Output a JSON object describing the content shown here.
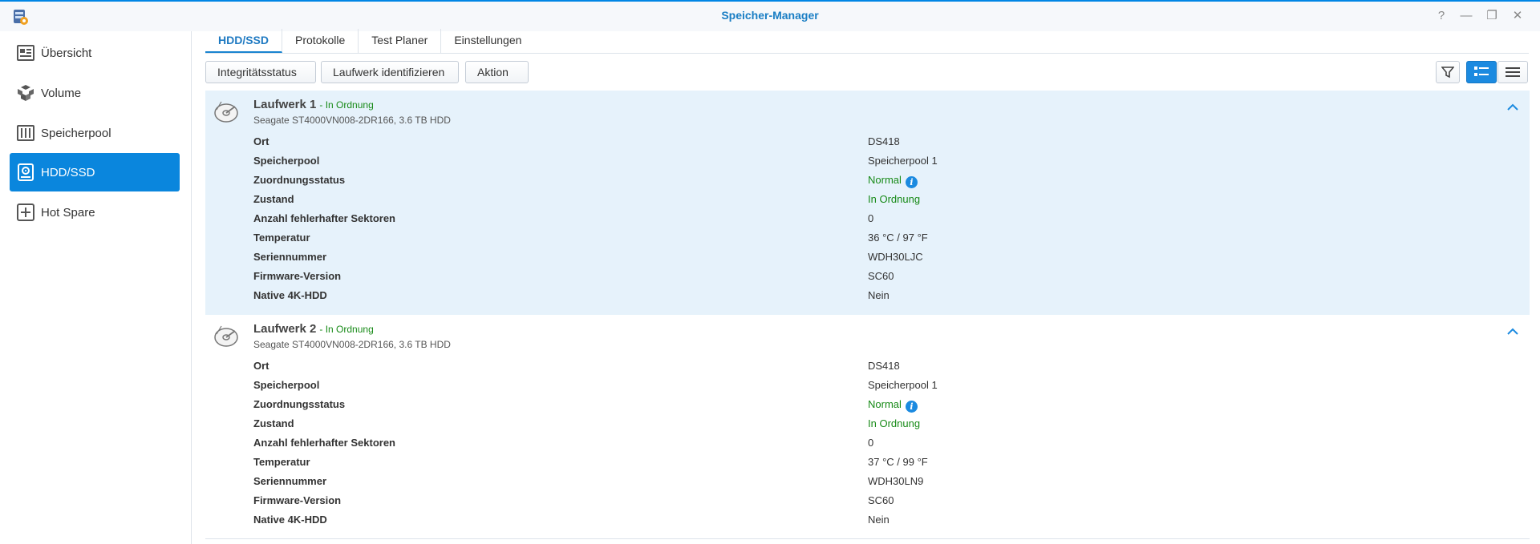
{
  "window": {
    "title": "Speicher-Manager",
    "controls": [
      {
        "name": "help-icon",
        "glyph": "?"
      },
      {
        "name": "minimize-icon",
        "glyph": "—"
      },
      {
        "name": "restore-icon",
        "glyph": "❐"
      },
      {
        "name": "close-icon",
        "glyph": "✕"
      }
    ]
  },
  "sidebar": {
    "items": [
      {
        "label": "Übersicht",
        "icon": "overview-icon",
        "active": false
      },
      {
        "label": "Volume",
        "icon": "volume-icon",
        "active": false
      },
      {
        "label": "Speicherpool",
        "icon": "storage-pool-icon",
        "active": false
      },
      {
        "label": "HDD/SSD",
        "icon": "hdd-icon",
        "active": true
      },
      {
        "label": "Hot Spare",
        "icon": "hot-spare-icon",
        "active": false
      }
    ]
  },
  "tabs": [
    {
      "label": "HDD/SSD",
      "active": true
    },
    {
      "label": "Protokolle",
      "active": false
    },
    {
      "label": "Test Planer",
      "active": false
    },
    {
      "label": "Einstellungen",
      "active": false
    }
  ],
  "toolbar": {
    "integrity_label": "Integritätsstatus",
    "identify_label": "Laufwerk identifizieren",
    "action_label": "Aktion",
    "action_caret": "▾",
    "filter_icon": "filter-icon",
    "view_detail_icon": "detail-view-icon",
    "view_list_icon": "list-view-icon"
  },
  "colors": {
    "accent": "#0a86dd",
    "title": "#1a7ec4",
    "ok_green": "#178a17",
    "selected_bg": "#e6f2fb"
  },
  "drives": [
    {
      "name": "Laufwerk 1",
      "status": "- In Ordnung",
      "model": "Seagate ST4000VN008-2DR166, 3.6 TB HDD",
      "selected": true,
      "details": [
        {
          "key": "Ort",
          "value": "DS418"
        },
        {
          "key": "Speicherpool",
          "value": "Speicherpool 1"
        },
        {
          "key": "Zuordnungsstatus",
          "value": "Normal",
          "green": true,
          "info": true
        },
        {
          "key": "Zustand",
          "value": "In Ordnung",
          "green": true
        },
        {
          "key": "Anzahl fehlerhafter Sektoren",
          "value": "0"
        },
        {
          "key": "Temperatur",
          "value": "36 °C / 97 °F"
        },
        {
          "key": "Seriennummer",
          "value": "WDH30LJC"
        },
        {
          "key": "Firmware-Version",
          "value": "SC60"
        },
        {
          "key": "Native 4K-HDD",
          "value": "Nein"
        }
      ]
    },
    {
      "name": "Laufwerk 2",
      "status": "- In Ordnung",
      "model": "Seagate ST4000VN008-2DR166, 3.6 TB HDD",
      "selected": false,
      "details": [
        {
          "key": "Ort",
          "value": "DS418"
        },
        {
          "key": "Speicherpool",
          "value": "Speicherpool 1"
        },
        {
          "key": "Zuordnungsstatus",
          "value": "Normal",
          "green": true,
          "info": true
        },
        {
          "key": "Zustand",
          "value": "In Ordnung",
          "green": true
        },
        {
          "key": "Anzahl fehlerhafter Sektoren",
          "value": "0"
        },
        {
          "key": "Temperatur",
          "value": "37 °C / 99 °F"
        },
        {
          "key": "Seriennummer",
          "value": "WDH30LN9"
        },
        {
          "key": "Firmware-Version",
          "value": "SC60"
        },
        {
          "key": "Native 4K-HDD",
          "value": "Nein"
        }
      ]
    }
  ]
}
